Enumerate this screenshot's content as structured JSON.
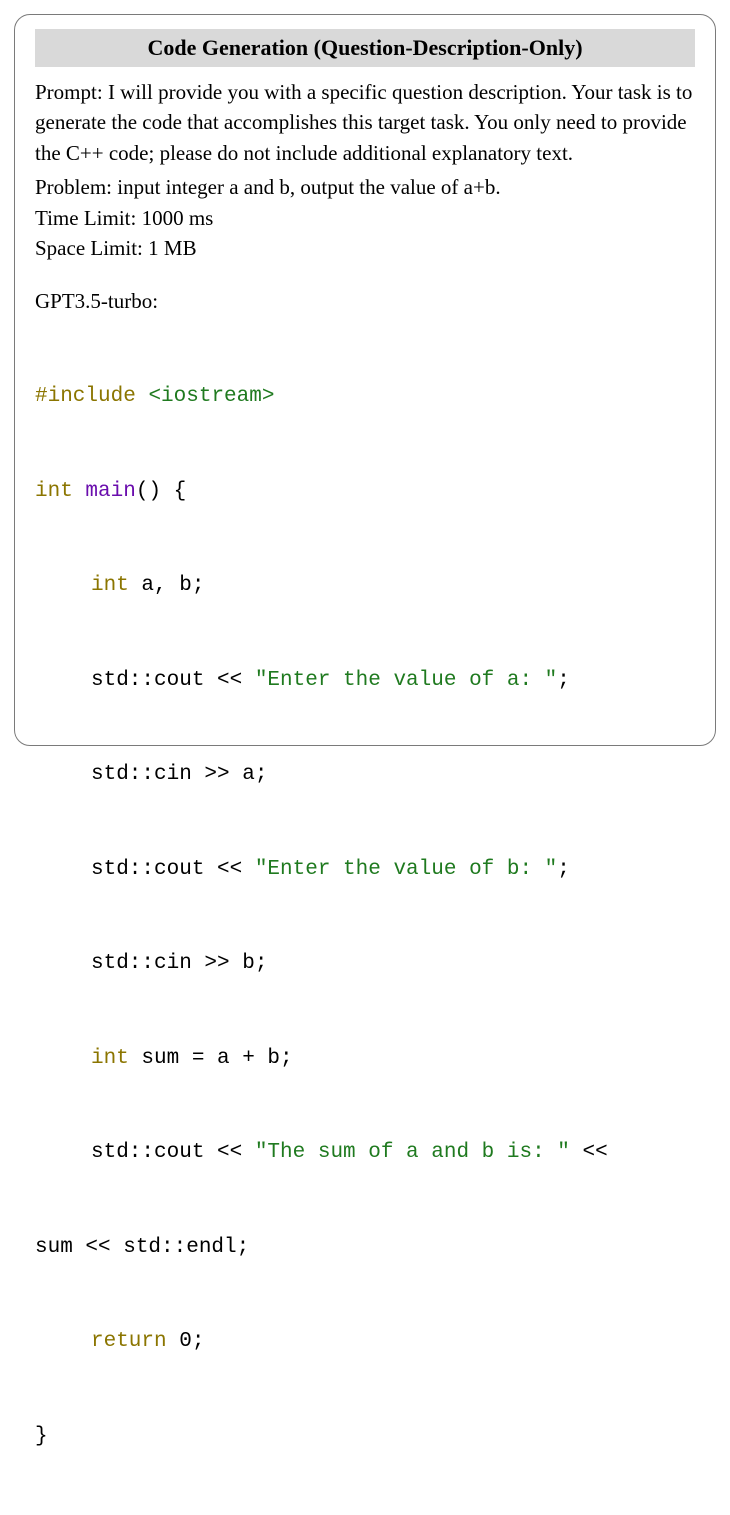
{
  "title": "Code Generation (Question-Description-Only)",
  "prompt_label": "Prompt: ",
  "prompt_text": "I will provide you with a specific question description. Your task is to generate the code that accomplishes this target task. You only need to provide the C++ code; please do not include additional explanatory text.",
  "problem_label": "Problem: ",
  "problem_text": "input integer a and b, output the value of a+b.",
  "time_label": "Time Limit: ",
  "time_value": "1000 ms",
  "space_label": "Space Limit: ",
  "space_value": "1 MB",
  "model_label": "GPT3.5-turbo:",
  "code": {
    "l1a": "#include",
    "l1b": " ",
    "l1c": "<iostream>",
    "l2a": "int",
    "l2b": " ",
    "l2c": "main",
    "l2d": "() {",
    "l3a": "int",
    "l3b": " a, b;",
    "l4a": "std::cout << ",
    "l4b": "\"Enter the value of a: \"",
    "l4c": ";",
    "l5a": "std::cin >> a;",
    "l6a": "std::cout << ",
    "l6b": "\"Enter the value of b: \"",
    "l6c": ";",
    "l7a": "std::cin >> b;",
    "l8a": "int",
    "l8b": " sum = a + b;",
    "l9a": "std::cout << ",
    "l9b": "\"The sum of a and b is: \"",
    "l9c": " <<",
    "l10a": "sum << std::endl;",
    "l11a": "return",
    "l11b": " 0;",
    "l12a": "}"
  }
}
